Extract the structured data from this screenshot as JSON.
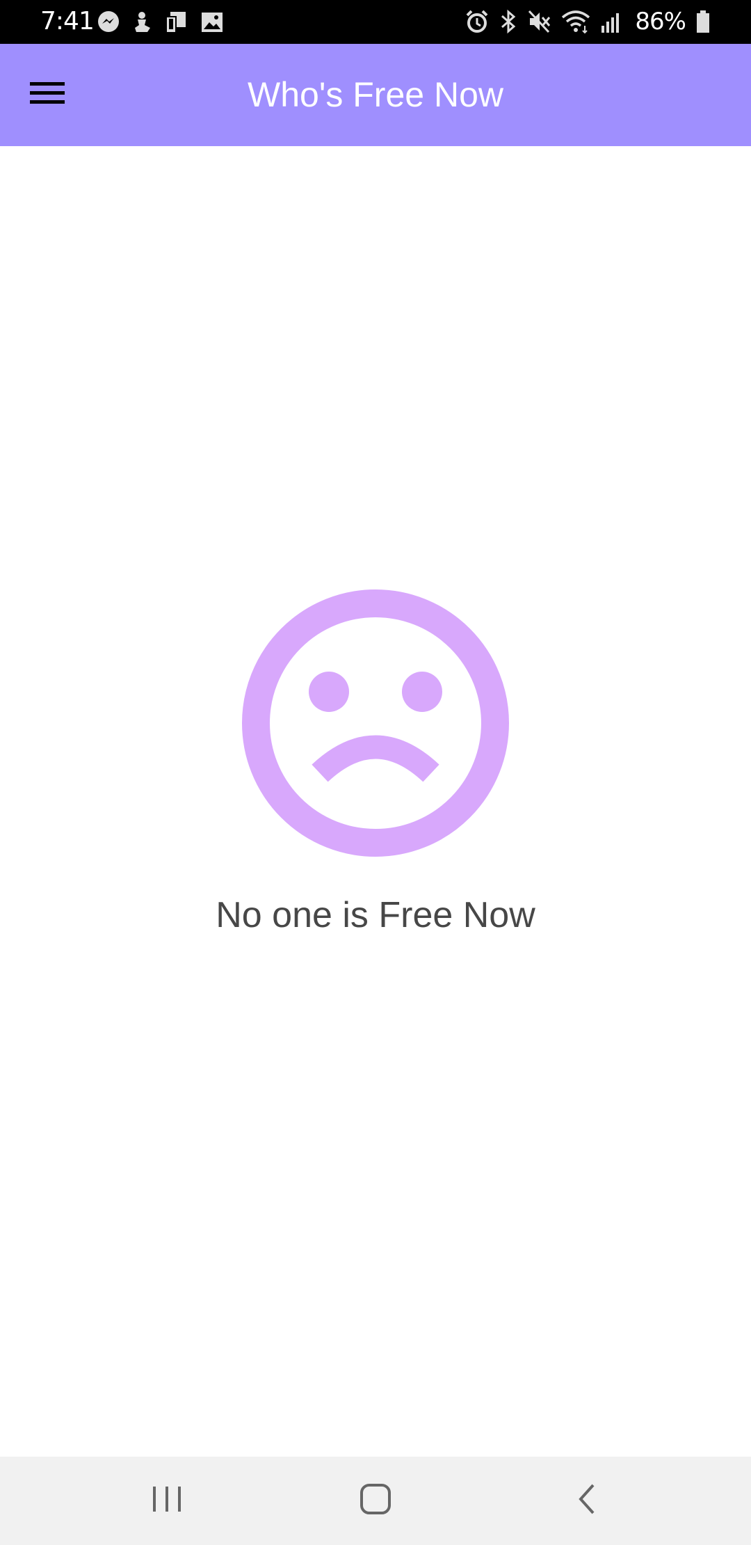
{
  "status_bar": {
    "time": "7:41",
    "left_icons": [
      "messenger-icon",
      "notification-app-icon",
      "screen-mirror-icon",
      "gallery-icon"
    ],
    "right_icons": [
      "alarm-icon",
      "bluetooth-icon",
      "mute-icon",
      "wifi-icon",
      "signal-icon",
      "battery-icon"
    ],
    "battery_percent": "86%"
  },
  "app_bar": {
    "title": "Who's Free Now",
    "background_color": "#9f8ffe",
    "menu_icon": "hamburger-menu-icon"
  },
  "empty_state": {
    "icon": "sad-face-icon",
    "icon_color": "#d8a8fc",
    "message": "No one is Free Now"
  },
  "nav_bar": {
    "buttons": [
      "recents-icon",
      "home-icon",
      "back-icon"
    ]
  }
}
